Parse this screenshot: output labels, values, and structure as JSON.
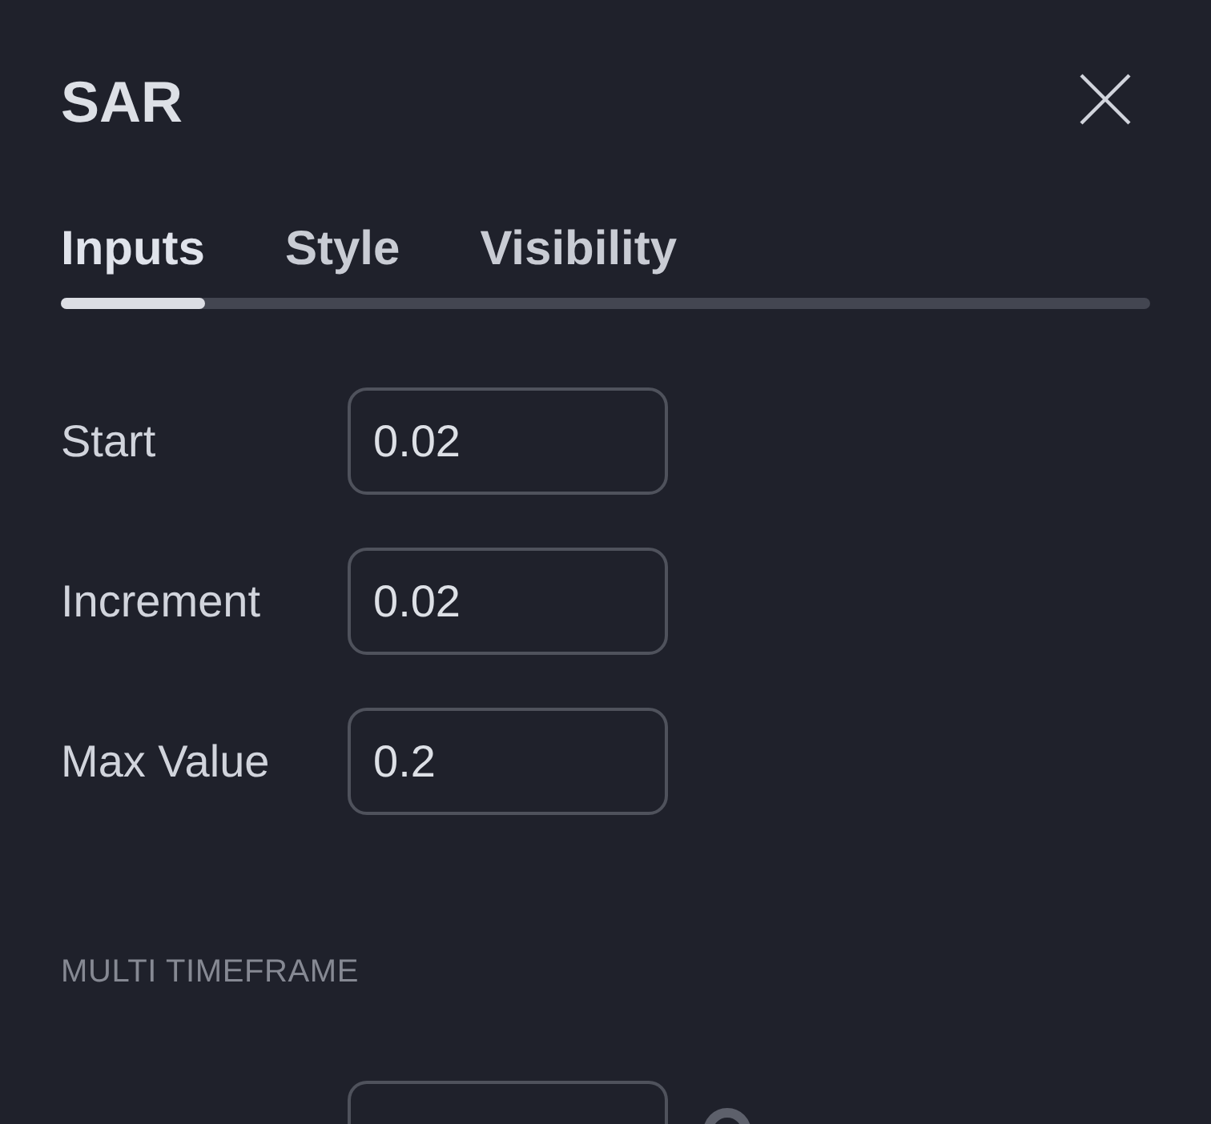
{
  "dialog": {
    "title": "SAR"
  },
  "tabs": [
    {
      "label": "Inputs",
      "selected": true
    },
    {
      "label": "Style",
      "selected": false
    },
    {
      "label": "Visibility",
      "selected": false
    }
  ],
  "inputs": [
    {
      "label": "Start",
      "value": "0.02"
    },
    {
      "label": "Increment",
      "value": "0.02"
    },
    {
      "label": "Max Value",
      "value": "0.2"
    }
  ],
  "sections": [
    {
      "heading": "MULTI TIMEFRAME",
      "fields": [
        {
          "kind": "select",
          "trailing_icon": true
        }
      ]
    }
  ]
}
